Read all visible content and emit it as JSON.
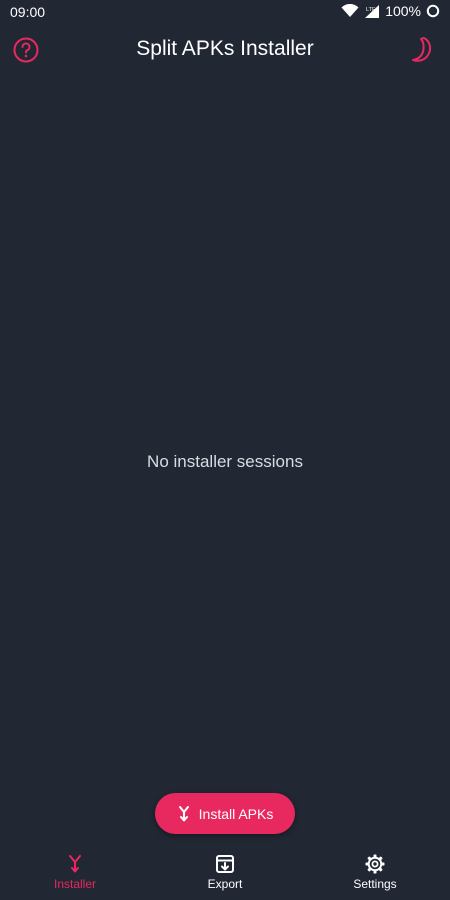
{
  "status_bar": {
    "time": "09:00",
    "battery": "100%",
    "network_label": "LTE"
  },
  "app_bar": {
    "title": "Split APKs Installer",
    "left_icon": "help-circle-icon",
    "right_icon": "moon-icon"
  },
  "main": {
    "empty_message": "No installer sessions"
  },
  "fab": {
    "label": "Install APKs",
    "icon": "fork-arrow-icon"
  },
  "bottom_nav": {
    "items": [
      {
        "label": "Installer",
        "icon": "fork-arrow-icon",
        "active": true
      },
      {
        "label": "Export",
        "icon": "archive-icon",
        "active": false
      },
      {
        "label": "Settings",
        "icon": "gear-icon",
        "active": false
      }
    ]
  },
  "colors": {
    "background": "#212733",
    "accent": "#e8295f",
    "text": "#ffffff",
    "muted_text": "#d9dce2"
  }
}
